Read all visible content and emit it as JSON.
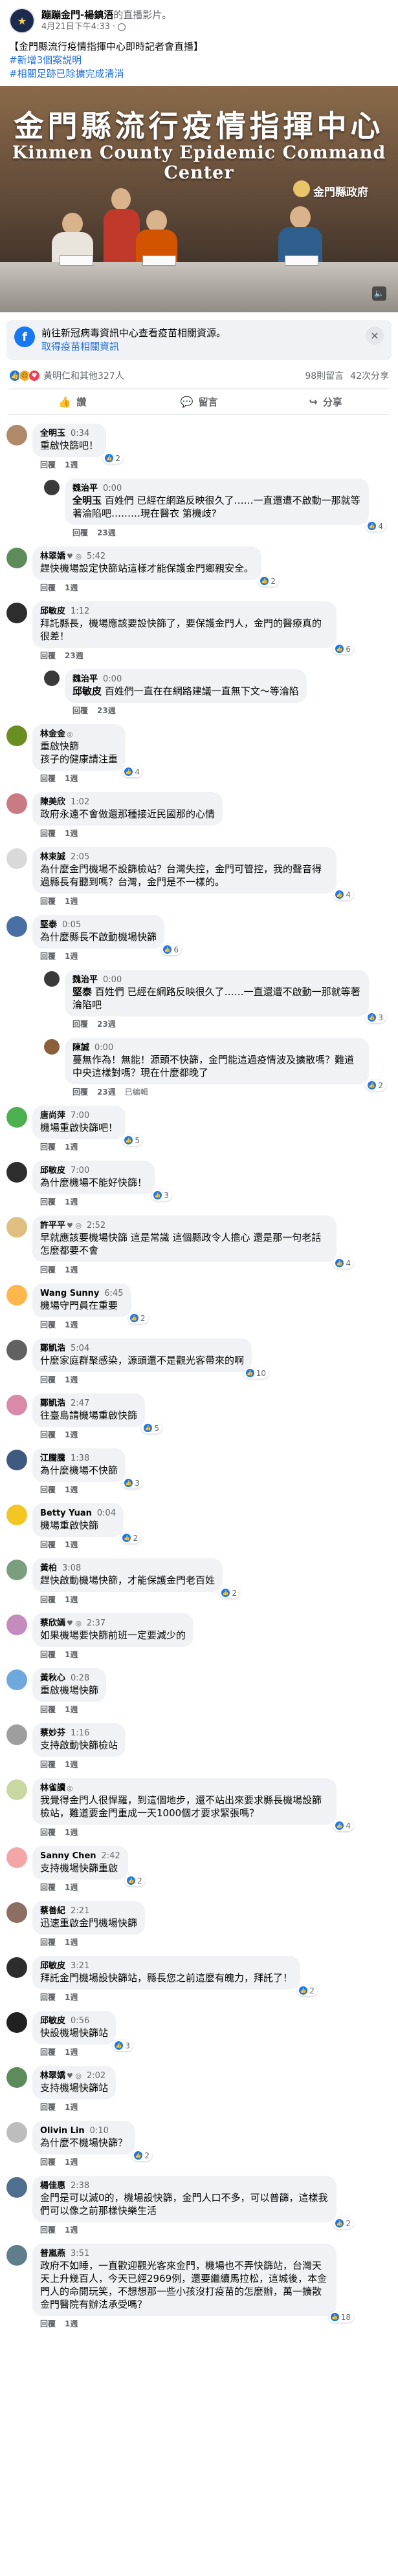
{
  "post": {
    "author": "蹦蹦金門-楊鎮浯",
    "author_suffix": "的直播影片。",
    "timestamp": "4月21日下午4:33",
    "text_lines": [
      "【金門縣流行疫情指揮中心即時記者會直播】"
    ],
    "hashtags": [
      "#新增3個案説明",
      "#相關足跡已除擴完成清消"
    ]
  },
  "banner": {
    "title_zh": "金門縣流行疫情指揮中心",
    "title_en": "Kinmen County Epidemic Command Center",
    "logo_text": "金門縣政府",
    "sound_icon": "speaker-icon"
  },
  "info_card": {
    "text": "前往新冠病毒資訊中心查看疫苗相關資源。",
    "link": "取得疫苗相關資訊",
    "icon": "info-icon"
  },
  "reactions": {
    "summary": "黃明仁和其他327人",
    "comments_count": "98則留言",
    "views": "42次分享"
  },
  "actions": {
    "like": "讚",
    "comment": "留言",
    "share": "分享"
  },
  "comments": [
    {
      "name": "全明玉",
      "badge": "",
      "time": "0:34",
      "text": "重啟快篩吧！",
      "actions": [
        "回覆",
        "1週"
      ],
      "react": "2",
      "reply": false,
      "color": "#b08968"
    },
    {
      "name": "魏治平",
      "badge": "",
      "time": "0:00",
      "mention": "全明玉",
      "text": "百姓們 已經在網路反映很久了……一直還遭不啟動一那就等著淪陷吧………現在醫衣 第機歧? ",
      "actions": [
        "回覆",
        "23週"
      ],
      "react": "4",
      "reply": true,
      "color": "#3a3a3a"
    },
    {
      "name": "林翠嬌",
      "badge": "♥ ◎",
      "time": "5:42",
      "text": "趕快機場設定快篩站這樣才能保護金門鄉親安全。",
      "actions": [
        "回覆",
        "1週"
      ],
      "react": "2",
      "reply": false,
      "color": "#5b8c5a"
    },
    {
      "name": "邱敏皮",
      "badge": "",
      "time": "1:12",
      "text": "拜託縣長，機場應該要設快篩了，要保護金門人，金門的醫療真的很差！",
      "actions": [
        "回覆",
        "23週"
      ],
      "react": "6",
      "reply": false,
      "color": "#2d2d2d"
    },
    {
      "name": "魏治平",
      "badge": "",
      "time": "0:00",
      "mention": "邱敏皮",
      "text": "百姓們一直在在網路建議一直無下文～等淪陷",
      "actions": [
        "回覆",
        "23週"
      ],
      "react": "",
      "reply": true,
      "color": "#3a3a3a"
    },
    {
      "name": "林金金",
      "badge": "◎",
      "time": "",
      "text": "重啟快篩\n孩子的健康請注重",
      "actions": [
        "回覆",
        "1週"
      ],
      "react": "4",
      "reply": false,
      "color": "#6b8e23"
    },
    {
      "name": "陳美欣",
      "badge": "",
      "time": "1:02",
      "text": "政府永遠不會做還那種接近民國那的心情",
      "actions": [
        "回覆",
        "1週"
      ],
      "react": "",
      "reply": false,
      "color": "#c97b84"
    },
    {
      "name": "林束誠",
      "badge": "",
      "time": "2:05",
      "text": "為什麼金門機場不設篩檢站？台灣失控，金門可管控，我的聲音得過縣長有聽到嗎？台灣，金門是不一樣的。",
      "actions": [
        "回覆",
        "1週"
      ],
      "react": "4",
      "reply": false,
      "color": "#d9d9d9"
    },
    {
      "name": "堅泰",
      "badge": "",
      "time": "0:05",
      "text": "為什麼縣長不啟動機場快篩",
      "actions": [
        "回覆",
        "1週"
      ],
      "react": "6",
      "reply": false,
      "color": "#4a6fa5"
    },
    {
      "name": "魏治平",
      "badge": "",
      "time": "0:00",
      "mention": "堅泰",
      "text": "百姓們 已經在網路反映很久了……一直還遭不啟動一那就等著淪陷吧",
      "actions": [
        "回覆",
        "23週"
      ],
      "react": "3",
      "reply": true,
      "color": "#3a3a3a"
    },
    {
      "name": "陳誠",
      "badge": "",
      "time": "0:00",
      "text": "蔓無作為！無能！源頭不快篩，金門能這過疫情波及擴散嗎？難道中央這樣對嗎？現在什麼都晚了",
      "actions": [
        "回覆",
        "23週",
        "已編輯"
      ],
      "react": "2",
      "reply": true,
      "color": "#8b5e3c"
    },
    {
      "name": "唐尚萍",
      "badge": "",
      "time": "7:00",
      "text": "機場重啟快篩吧！",
      "actions": [
        "回覆",
        "1週"
      ],
      "react": "5",
      "reply": false,
      "color": "#4caf50"
    },
    {
      "name": "邱敏皮",
      "badge": "",
      "time": "7:00",
      "text": "為什麼機場不能好快篩！",
      "actions": [
        "回覆",
        "1週"
      ],
      "react": "3",
      "reply": false,
      "color": "#2d2d2d"
    },
    {
      "name": "許平平",
      "badge": "♥ ◎",
      "time": "2:52",
      "text": "早就應該要機場快篩 這是常識 這個縣政令人擔心 還是那一句老話 怎麼都要不會",
      "actions": [
        "回覆",
        "1週"
      ],
      "react": "4",
      "reply": false,
      "color": "#e0c080"
    },
    {
      "name": "Wang Sunny",
      "badge": "",
      "time": "6:45",
      "text": "機場守門員在重要",
      "actions": [
        "回覆",
        "1週"
      ],
      "react": "2",
      "reply": false,
      "color": "#ffb74d"
    },
    {
      "name": "鄭凱浩",
      "badge": "",
      "time": "5:04",
      "text": "什麼家庭群聚感染，源頭還不是觀光客帶來的啊",
      "actions": [
        "回覆",
        "1週"
      ],
      "react": "10",
      "reply": false,
      "color": "#616161"
    },
    {
      "name": "鄭凱浩",
      "badge": "",
      "time": "2:47",
      "text": "往臺島請機場重啟快篩",
      "actions": [
        "回覆",
        "1週"
      ],
      "react": "5",
      "reply": false,
      "color": "#d88aa8"
    },
    {
      "name": "江騰騰",
      "badge": "",
      "time": "1:38",
      "text": "為什麼機場不快篩",
      "actions": [
        "回覆",
        "1週"
      ],
      "react": "3",
      "reply": false,
      "color": "#3e5a80"
    },
    {
      "name": "Betty Yuan",
      "badge": "",
      "time": "0:04",
      "text": "機場重啟快篩",
      "actions": [
        "回覆",
        "1週"
      ],
      "react": "2",
      "reply": false,
      "color": "#f3c623"
    },
    {
      "name": "黃柏",
      "badge": "",
      "time": "3:08",
      "text": "趕快啟動機場快篩，才能保護金門老百姓",
      "actions": [
        "回覆",
        "1週"
      ],
      "react": "2",
      "reply": false,
      "color": "#7a9e7e"
    },
    {
      "name": "蔡欣嫣",
      "badge": "♥ ◎",
      "time": "2:37",
      "text": "如果機場要快篩前班一定要減少的",
      "actions": [
        "回覆",
        "1週"
      ],
      "react": "",
      "reply": false,
      "color": "#c48bbf"
    },
    {
      "name": "黃秋心",
      "badge": "",
      "time": "0:28",
      "text": "重啟機場快篩",
      "actions": [
        "回覆",
        "1週"
      ],
      "react": "",
      "reply": false,
      "color": "#6fa8dc"
    },
    {
      "name": "蔡妙芬",
      "badge": "",
      "time": "1:16",
      "text": "支持啟動快篩檢站",
      "actions": [
        "回覆",
        "1週"
      ],
      "react": "",
      "reply": false,
      "color": "#9e9e9e"
    },
    {
      "name": "林雀讀",
      "badge": "◎",
      "time": "",
      "text": "我覺得金門人很悍羅，到這個地步，還不站出來要求縣長機場設篩檢站，難道要金門重成一天1000個才要求緊張嗎？",
      "actions": [
        "回覆",
        "1週"
      ],
      "react": "4",
      "reply": false,
      "color": "#c8d8a0"
    },
    {
      "name": "Sanny Chen",
      "badge": "",
      "time": "2:42",
      "text": "支持機場快篩重啟",
      "actions": [
        "回覆",
        "1週"
      ],
      "react": "2",
      "reply": false,
      "color": "#f4a6a6"
    },
    {
      "name": "蔡善紀",
      "badge": "",
      "time": "2:21",
      "text": "迅速重啟金門機場快篩",
      "actions": [
        "回覆",
        "1週"
      ],
      "react": "",
      "reply": false,
      "color": "#8d6e63"
    },
    {
      "name": "邱敏皮",
      "badge": "",
      "time": "3:21",
      "text": "拜託金門機場設快篩站，縣長您之前這麼有魄力，拜託了！",
      "actions": [
        "回覆",
        "1週"
      ],
      "react": "2",
      "reply": false,
      "color": "#2d2d2d"
    },
    {
      "name": "邱敏皮",
      "badge": "",
      "time": "0:56",
      "text": "快設機場快篩站",
      "actions": [
        "回覆",
        "1週"
      ],
      "react": "3",
      "reply": false,
      "color": "#212121"
    },
    {
      "name": "林翠嬌",
      "badge": "♥ ◎",
      "time": "2:02",
      "text": "支持機場快篩站",
      "actions": [
        "回覆",
        "1週"
      ],
      "react": "",
      "reply": false,
      "color": "#5b8c5a"
    },
    {
      "name": "Olivin Lin",
      "badge": "",
      "time": "0:10",
      "text": "為什麼不機場快篩？",
      "actions": [
        "回覆",
        "1週"
      ],
      "react": "2",
      "reply": false,
      "color": "#bdbdbd"
    },
    {
      "name": "楊佳惠",
      "badge": "",
      "time": "2:38",
      "text": "金門是可以滅0的，機場設快篩，金門人口不多，可以普篩，這樣我們可以像之前那樣快樂生活",
      "actions": [
        "回覆",
        "1週"
      ],
      "react": "2",
      "reply": false,
      "color": "#4f6f8f"
    },
    {
      "name": "普嵐燕",
      "badge": "",
      "time": "3:51",
      "text": "政府不如睡，一直歡迎觀光客來金門，機場也不弄快篩站，台灣天天上升幾百人，今天已經2969例，還要繼續馬拉松，這城後，本金門人的命開玩笑，不想想那一些小孩沒打疫苗的怎麼辦，萬一擴散金門醫院有辦法承受嗎？",
      "actions": [
        "回覆",
        "1週"
      ],
      "react": "18",
      "reply": false,
      "color": "#607d8b"
    }
  ]
}
